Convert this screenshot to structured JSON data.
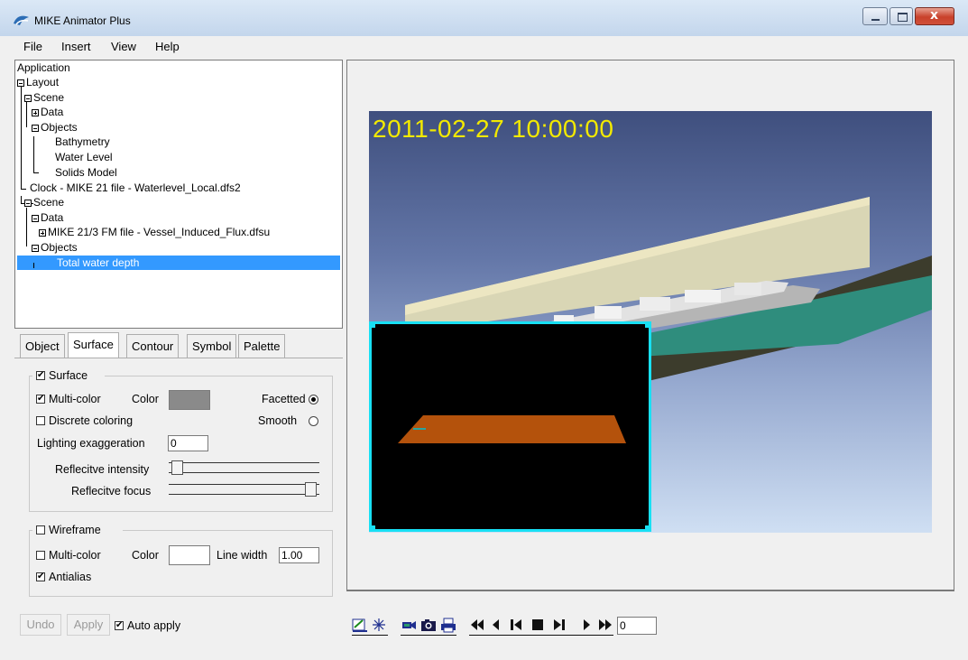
{
  "window": {
    "title": "MIKE Animator Plus",
    "close_glyph": "x"
  },
  "menu": {
    "items": [
      "File",
      "Insert",
      "View",
      "Help"
    ]
  },
  "tree": {
    "items": [
      "Application",
      "Layout",
      "Scene",
      "Data",
      "Objects",
      "Bathymetry",
      "Water Level",
      "Solids Model",
      "Clock - MIKE 21 file - Waterlevel_Local.dfs2",
      "Scene",
      "Data",
      "MIKE 21/3 FM file - Vessel_Induced_Flux.dfsu",
      "Objects",
      "Total water depth"
    ],
    "selected": "Total water depth"
  },
  "tabs": [
    "Object",
    "Surface",
    "Contour",
    "Symbol",
    "Palette"
  ],
  "active_tab": "Surface",
  "surface": {
    "group_label": "Surface",
    "multicolor_label": "Multi-color",
    "color_label": "Color",
    "color_value": "#8a8a8a",
    "facetted_label": "Facetted",
    "discrete_label": "Discrete coloring",
    "smooth_label": "Smooth",
    "lighting_label": "Lighting exaggeration",
    "lighting_value": "0",
    "reflective_intensity_label": "Reflecitve intensity",
    "reflective_focus_label": "Reflecitve focus",
    "reflective_intensity_level": 0.02,
    "reflective_focus_level": 0.98
  },
  "wireframe": {
    "group_label": "Wireframe",
    "multicolor_label": "Multi-color",
    "color_label": "Color",
    "color_value": "#ffffff",
    "line_width_label": "Line width",
    "line_width_value": "1.00",
    "antialias_label": "Antialias"
  },
  "footer": {
    "undo_label": "Undo",
    "apply_label": "Apply",
    "auto_apply_label": "Auto apply"
  },
  "viewer": {
    "timestamp": "2011-02-27 10:00:00",
    "accent_color": "#18e0f4",
    "timestamp_color": "#f2e900"
  },
  "controls": {
    "frame_value": "0",
    "buttons": [
      "edit-layout",
      "pointer",
      "record-video",
      "snapshot",
      "print",
      "first-frame",
      "step-back",
      "play-backward",
      "stop",
      "play-forward",
      "step-forward",
      "last-frame"
    ]
  },
  "checks": {
    "mark": "✔"
  }
}
